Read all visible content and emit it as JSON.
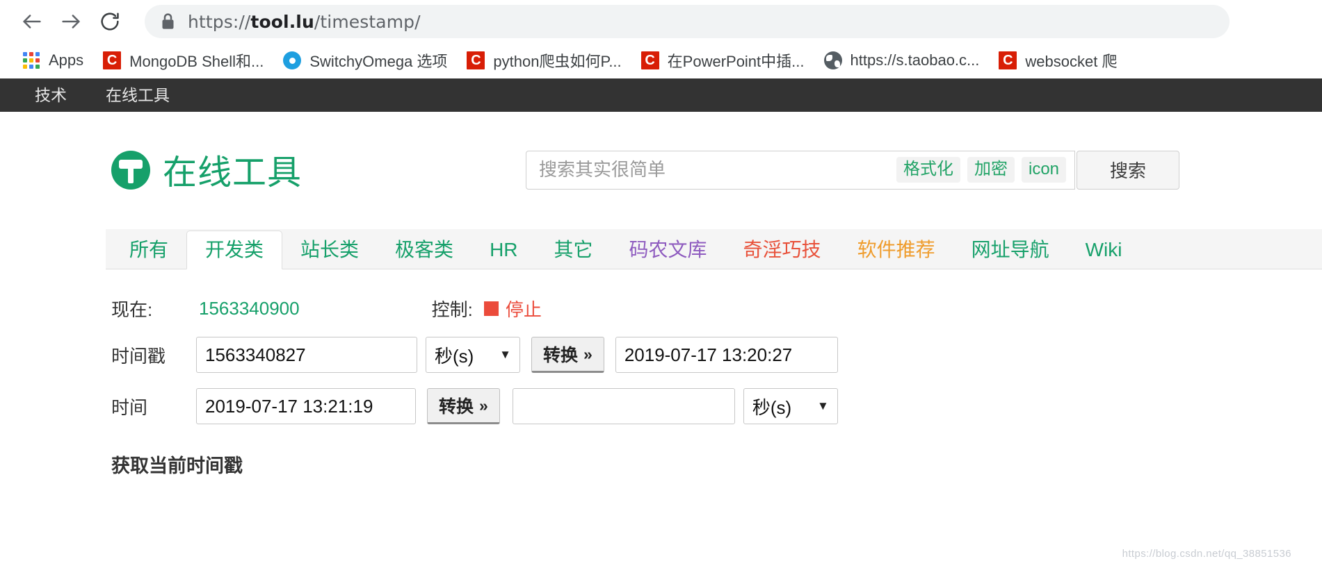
{
  "browser": {
    "back_icon": "arrow-left-icon",
    "forward_icon": "arrow-right-icon",
    "reload_icon": "reload-icon",
    "lock_icon": "lock-icon",
    "url_scheme": "https://",
    "url_host": "tool.lu",
    "url_path": "/timestamp/",
    "bookmarks": [
      {
        "label": "Apps",
        "icon": "apps-grid-icon"
      },
      {
        "label": "MongoDB Shell和...",
        "icon": "csdn-icon"
      },
      {
        "label": "SwitchyOmega 选项",
        "icon": "switchyomega-icon"
      },
      {
        "label": "python爬虫如何P...",
        "icon": "csdn-icon"
      },
      {
        "label": "在PowerPoint中插...",
        "icon": "csdn-icon"
      },
      {
        "label": "https://s.taobao.c...",
        "icon": "globe-icon"
      },
      {
        "label": "websocket 爬",
        "icon": "csdn-icon"
      }
    ]
  },
  "site_nav": {
    "items": [
      {
        "label": "技术"
      },
      {
        "label": "在线工具"
      }
    ]
  },
  "header": {
    "logo_text": "在线工具",
    "logo_icon": "hammer-circle-icon",
    "logo_color": "#16a06a"
  },
  "search": {
    "placeholder": "搜索其实很简单",
    "value": "",
    "chips": [
      {
        "label": "格式化"
      },
      {
        "label": "加密"
      },
      {
        "label": "icon"
      }
    ],
    "button_label": "搜索",
    "chip_color": "#21a366"
  },
  "tabs": [
    {
      "label": "所有",
      "color": "#16a06a",
      "active": false
    },
    {
      "label": "开发类",
      "color": "#16a06a",
      "active": true
    },
    {
      "label": "站长类",
      "color": "#16a06a",
      "active": false
    },
    {
      "label": "极客类",
      "color": "#16a06a",
      "active": false
    },
    {
      "label": "HR",
      "color": "#16a06a",
      "active": false
    },
    {
      "label": "其它",
      "color": "#16a06a",
      "active": false
    },
    {
      "label": "码农文库",
      "color": "#8e5bbf",
      "active": false
    },
    {
      "label": "奇淫巧技",
      "color": "#e8513a",
      "active": false
    },
    {
      "label": "软件推荐",
      "color": "#ef9c2c",
      "active": false
    },
    {
      "label": "网址导航",
      "color": "#16a06a",
      "active": false
    },
    {
      "label": "Wiki",
      "color": "#16a06a",
      "active": false
    }
  ],
  "tool": {
    "now_label": "现在:",
    "now_value": "1563340900",
    "now_color": "#16a06a",
    "control_label": "控制:",
    "stop_label": "停止",
    "stop_color": "#eb4b3b",
    "row_timestamp": {
      "label": "时间戳",
      "input_value": "1563340827",
      "unit_value": "秒(s)",
      "convert_label": "转换",
      "convert_chevron": "»",
      "result_value": "2019-07-17 13:20:27"
    },
    "row_time": {
      "label": "时间",
      "input_value": "2019-07-17 13:21:19",
      "convert_label": "转换",
      "convert_chevron": "»",
      "result_value": "",
      "unit_value": "秒(s)"
    },
    "section_title": "获取当前时间戳"
  },
  "watermark": "https://blog.csdn.net/qq_38851536"
}
